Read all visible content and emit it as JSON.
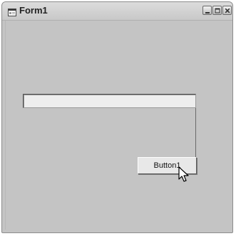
{
  "window": {
    "title": "Form1",
    "icon": "form-icon",
    "controls": [
      "minimize-icon",
      "maximize-icon",
      "close-icon"
    ]
  },
  "form": {
    "textbox_value": "",
    "button_label": "Button1"
  },
  "cursor": {
    "icon": "mouse-pointer-icon"
  },
  "colors": {
    "form_background": "#c4c4c4",
    "textbox_background": "#eeeeee",
    "button_background": "#e8e8e8"
  }
}
